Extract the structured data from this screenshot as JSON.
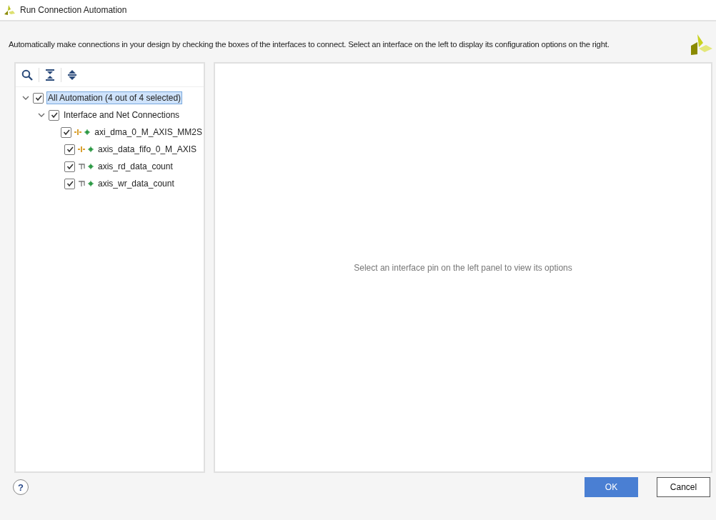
{
  "window": {
    "title": "Run Connection Automation"
  },
  "description": "Automatically make connections in your design by checking the boxes of the interfaces to connect. Select an interface on the left to display its configuration options on the right.",
  "tree": [
    {
      "label": "All Automation (4 out of 4 selected)",
      "checked": true,
      "expanded": true,
      "selected": true,
      "children": [
        {
          "label": "Interface and Net Connections",
          "checked": true,
          "expanded": true,
          "selected": false,
          "children": [
            {
              "label": "axi_dma_0_M_AXIS_MM2S",
              "checked": true,
              "selected": false,
              "kind": "interface"
            },
            {
              "label": "axis_data_fifo_0_M_AXIS",
              "checked": true,
              "selected": false,
              "kind": "interface"
            },
            {
              "label": "axis_rd_data_count",
              "checked": true,
              "selected": false,
              "kind": "net"
            },
            {
              "label": "axis_wr_data_count",
              "checked": true,
              "selected": false,
              "kind": "net"
            }
          ]
        }
      ]
    }
  ],
  "options_panel": {
    "message": "Select an interface pin on the left panel to view its options"
  },
  "help": {
    "label": "?"
  },
  "buttons": [
    {
      "label": "OK",
      "kind": "primary"
    },
    {
      "label": "Cancel",
      "kind": "secondary"
    }
  ]
}
